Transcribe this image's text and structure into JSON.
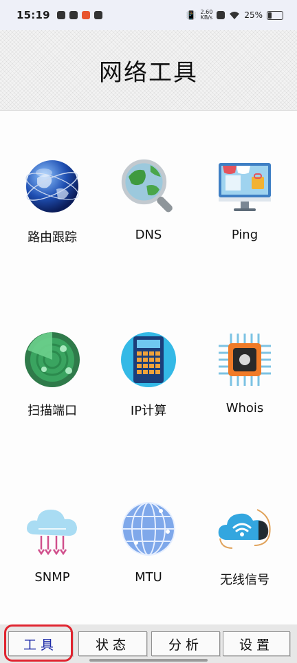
{
  "status_bar": {
    "time": "15:19",
    "net_speed_value": "2.60",
    "net_speed_unit": "KB/s",
    "battery": "25%"
  },
  "header": {
    "title": "网络工具"
  },
  "tools": [
    {
      "label": "路由跟踪",
      "icon": "globe-icon"
    },
    {
      "label": "DNS",
      "icon": "magnifier-globe-icon"
    },
    {
      "label": "Ping",
      "icon": "monitor-store-icon"
    },
    {
      "label": "扫描端口",
      "icon": "radar-icon"
    },
    {
      "label": "IP计算",
      "icon": "calculator-icon"
    },
    {
      "label": "Whois",
      "icon": "chip-icon"
    },
    {
      "label": "SNMP",
      "icon": "cloud-network-icon"
    },
    {
      "label": "MTU",
      "icon": "wire-globe-icon"
    },
    {
      "label": "无线信号",
      "icon": "wifi-cloud-icon"
    }
  ],
  "bottom_nav": {
    "tabs": [
      {
        "label": "工具",
        "active": true
      },
      {
        "label": "状态",
        "active": false
      },
      {
        "label": "分析",
        "active": false
      },
      {
        "label": "设置",
        "active": false
      }
    ],
    "active_color": "#1d2aa8",
    "highlight_color": "#e0242f"
  }
}
